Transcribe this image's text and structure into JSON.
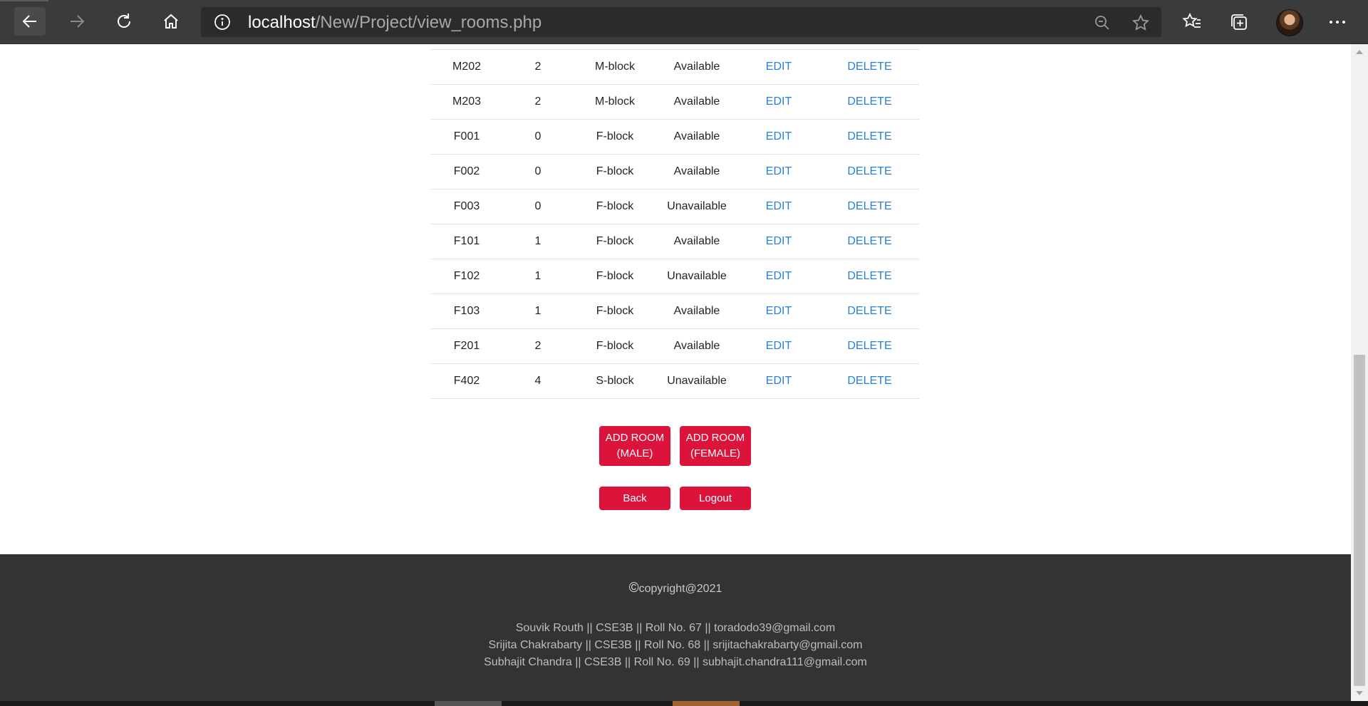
{
  "browser": {
    "url_host": "localhost",
    "url_path": "/New/Project/view_rooms.php"
  },
  "rooms": [
    {
      "room": "M202",
      "floor": "2",
      "block": "M-block",
      "status": "Available"
    },
    {
      "room": "M203",
      "floor": "2",
      "block": "M-block",
      "status": "Available"
    },
    {
      "room": "F001",
      "floor": "0",
      "block": "F-block",
      "status": "Available"
    },
    {
      "room": "F002",
      "floor": "0",
      "block": "F-block",
      "status": "Available"
    },
    {
      "room": "F003",
      "floor": "0",
      "block": "F-block",
      "status": "Unavailable"
    },
    {
      "room": "F101",
      "floor": "1",
      "block": "F-block",
      "status": "Available"
    },
    {
      "room": "F102",
      "floor": "1",
      "block": "F-block",
      "status": "Unavailable"
    },
    {
      "room": "F103",
      "floor": "1",
      "block": "F-block",
      "status": "Available"
    },
    {
      "room": "F201",
      "floor": "2",
      "block": "F-block",
      "status": "Available"
    },
    {
      "room": "F402",
      "floor": "4",
      "block": "S-block",
      "status": "Unavailable"
    }
  ],
  "actions": {
    "edit_label": "EDIT",
    "delete_label": "DELETE"
  },
  "buttons": {
    "add_male_line1": "ADD ROOM",
    "add_male_line2": "(MALE)",
    "add_female_line1": "ADD ROOM",
    "add_female_line2": "(FEMALE)",
    "back": "Back",
    "logout": "Logout"
  },
  "footer": {
    "copyright_symbol": "©",
    "copyright_text": "copyright@2021",
    "credits": [
      "Souvik Routh || CSE3B || Roll No. 67 || toradodo39@gmail.com",
      "Srijita Chakrabarty || CSE3B || Roll No. 68 || srijitachakrabarty@gmail.com",
      "Subhajit Chandra || CSE3B || Roll No. 69 || subhajit.chandra111@gmail.com"
    ]
  },
  "icons": {
    "back": "back-arrow-icon",
    "forward": "forward-arrow-icon",
    "refresh": "refresh-icon",
    "home": "home-icon",
    "site_info": "info-icon",
    "zoom": "zoom-out-icon",
    "add_favorite": "add-favorite-icon",
    "favorites": "favorites-icon",
    "collections": "collections-icon",
    "profile": "avatar",
    "menu": "more-icon"
  },
  "colors": {
    "accent_button": "#dc143c",
    "link": "#2680d8",
    "footer_bg": "#333333"
  }
}
